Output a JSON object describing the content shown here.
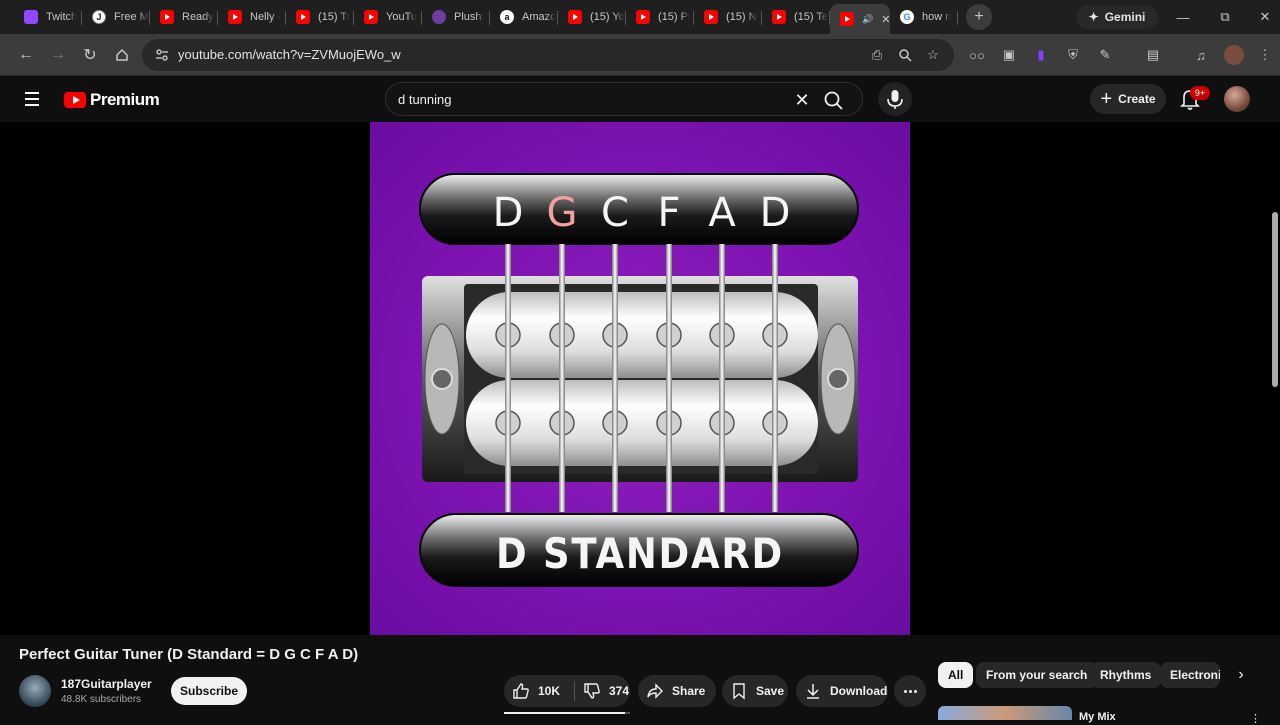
{
  "browser": {
    "tabs": [
      {
        "label": "Twitch",
        "icon": "twitch-icon"
      },
      {
        "label": "Free M",
        "icon": "j-site-icon"
      },
      {
        "label": "Ready",
        "icon": "youtube-icon"
      },
      {
        "label": "Nelly -",
        "icon": "youtube-icon"
      },
      {
        "label": "(15) Tr",
        "icon": "youtube-icon"
      },
      {
        "label": "YouTu",
        "icon": "youtube-icon"
      },
      {
        "label": "Plush:",
        "icon": "plush-icon"
      },
      {
        "label": "Amazo",
        "icon": "amazon-icon"
      },
      {
        "label": "(15) Yo",
        "icon": "youtube-icon"
      },
      {
        "label": "(15) Pi",
        "icon": "youtube-icon"
      },
      {
        "label": "(15) N",
        "icon": "youtube-icon"
      },
      {
        "label": "(15) Te",
        "icon": "youtube-icon"
      },
      {
        "label": "",
        "icon": "youtube-icon",
        "active": true
      },
      {
        "label": "how n",
        "icon": "google-icon"
      }
    ],
    "gemini_label": "Gemini",
    "url": "youtube.com/watch?v=ZVMuojEWo_w"
  },
  "masthead": {
    "logo_text": "Premium",
    "search_value": "d tunning",
    "create_label": "Create",
    "notifications_badge": "9+"
  },
  "player": {
    "tuning_notes": [
      "D",
      "G",
      "C",
      "F",
      "A",
      "D"
    ],
    "highlighted_note_index": 1,
    "plate_text": "D STANDARD",
    "background_color": "#7c12b0",
    "highlight_color": "#f4a0a0"
  },
  "video": {
    "title": "Perfect Guitar Tuner (D Standard = D G C F A D)",
    "channel_name": "187Guitarplayer",
    "subscribers": "48.8K subscribers",
    "subscribe_label": "Subscribe",
    "likes": "10K",
    "dislikes": "374",
    "like_ratio": 0.96,
    "share_label": "Share",
    "save_label": "Save",
    "download_label": "Download"
  },
  "chips": [
    "All",
    "From your search",
    "Rhythms",
    "Electronic"
  ],
  "sidebar": {
    "first_item_title": "My Mix"
  }
}
